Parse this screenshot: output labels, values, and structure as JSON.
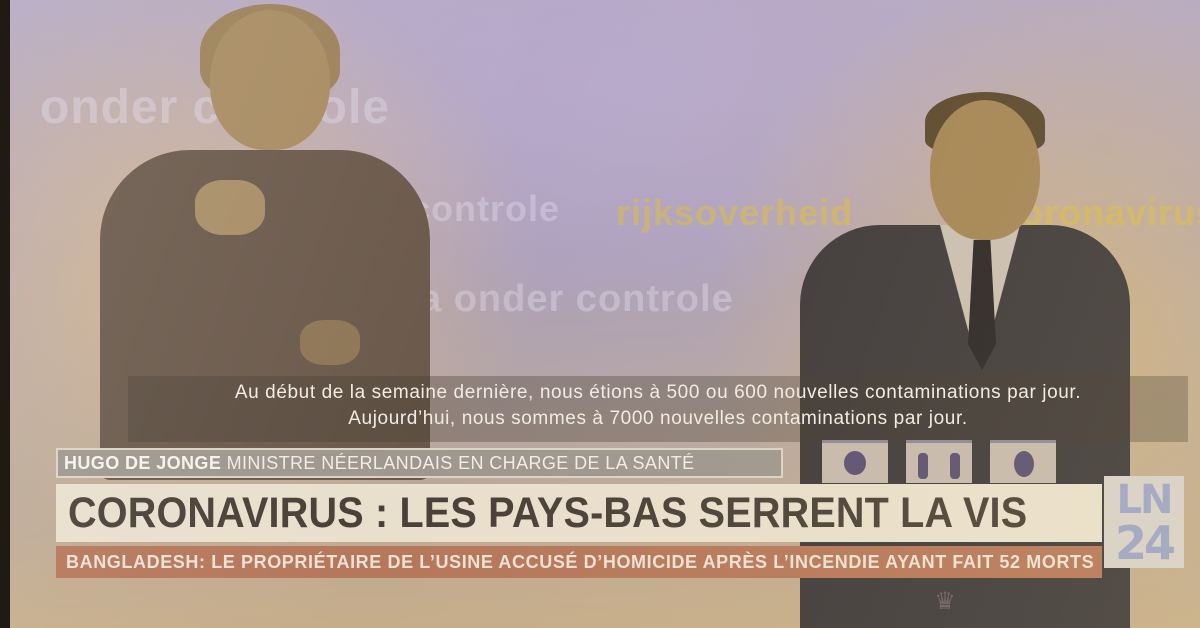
{
  "subtitles": {
    "line1": "Au début de la semaine dernière, nous étions à 500 ou 600 nouvelles contaminations par jour.",
    "line2": "Aujourd’hui, nous sommes à 7000 nouvelles contaminations par jour."
  },
  "lower_third": {
    "speaker_name": "HUGO DE JONGE",
    "speaker_role": "MINISTRE NÉERLANDAIS EN CHARGE DE LA SANTÉ",
    "headline": "CORONAVIRUS : LES PAYS-BAS SERRENT LA VIS",
    "ticker": "BANGLADESH: LE PROPRIÉTAIRE DE L’USINE ACCUSÉ D’HOMICIDE APRÈS L’INCENDIE AYANT FAIT 52 MORTS"
  },
  "logo": {
    "top": "LN",
    "bottom": "24"
  },
  "background_text": {
    "word1": "onder controle",
    "word2": "controle",
    "word3": "rijksoverheid",
    "word4": "coronavirus",
    "word5": "a onder controle"
  },
  "colors": {
    "headline_bg": "#e9dfcd",
    "ticker_bg": "#b6775a",
    "namebar_bg": "#9d978f",
    "logo_text": "#9aa4c6"
  }
}
